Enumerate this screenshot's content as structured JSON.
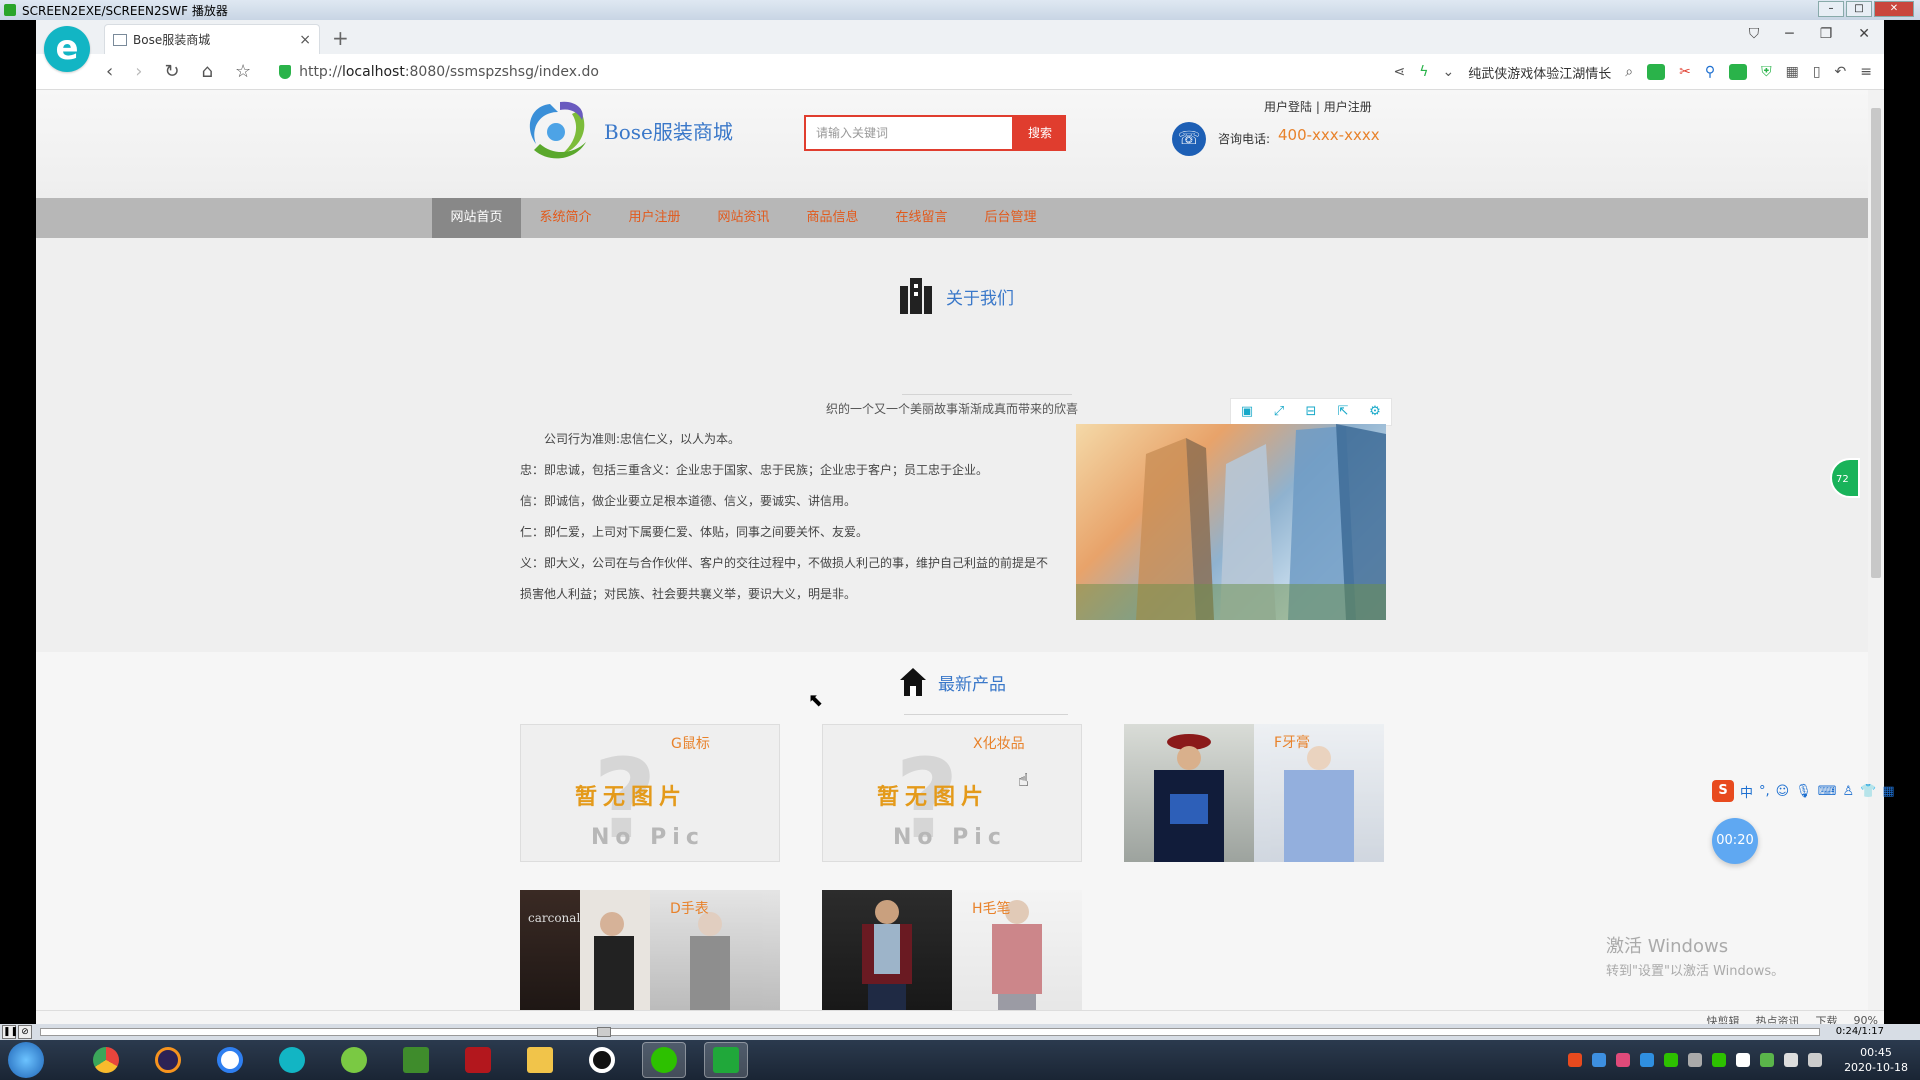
{
  "player": {
    "title": "SCREEN2EXE/SCREEN2SWF 播放器",
    "time": "0:24/1:17"
  },
  "browser": {
    "tab_title": "Bose服装商城",
    "url_prefix": "http://",
    "url_host": "localhost",
    "url_rest": ":8080/ssmspzshsg/index.do",
    "search_hint": "纯武侠游戏体验江湖情长",
    "status_items": [
      "快剪辑",
      "热点资讯",
      "下载",
      "90%"
    ]
  },
  "site": {
    "logo_text": "Bose服装商城",
    "search_placeholder": "请输入关键词",
    "search_button": "搜索",
    "user_login": "用户登陆",
    "user_register": "用户注册",
    "separator": "|",
    "phone_label": "咨询电话:",
    "phone_number": "400-xxx-xxxx",
    "nav": [
      "网站首页",
      "系统简介",
      "用户注册",
      "网站资讯",
      "商品信息",
      "在线留言",
      "后台管理"
    ]
  },
  "about": {
    "title": "关于我们",
    "tagline": "织的一个又一个美丽故事渐渐成真而带来的欣喜",
    "paragraphs": [
      "公司行为准则:忠信仁义，以人为本。",
      "忠：即忠诚，包括三重含义：企业忠于国家、忠于民族；企业忠于客户；员工忠于企业。",
      "信：即诚信，做企业要立足根本道德、信义，要诚实、讲信用。",
      "仁：即仁爱，上司对下属要仁爱、体贴，同事之间要关怀、友爱。",
      "义：即大义，公司在与合作伙伴、客户的交往过程中，不做损人利己的事，维护自己利益的前提是不",
      "损害他人利益；对民族、社会要共襄义举，要识大义，明是非。"
    ]
  },
  "products": {
    "title": "最新产品",
    "nopic_zh": "暂无图片",
    "nopic_en": "No Pic",
    "items": [
      {
        "name": "G鼠标",
        "image": "none"
      },
      {
        "name": "X化妆品",
        "image": "none"
      },
      {
        "name": "F牙膏",
        "image": "photo"
      },
      {
        "name": "D手表",
        "image": "photo"
      },
      {
        "name": "H毛笔",
        "image": "photo"
      }
    ]
  },
  "overlay": {
    "ime_label": "中",
    "timer": "00:20",
    "float_badge": "72",
    "activate_title": "激活 Windows",
    "activate_sub": "转到\"设置\"以激活 Windows。"
  },
  "taskbar": {
    "time": "00:45",
    "date": "2020-10-18"
  }
}
